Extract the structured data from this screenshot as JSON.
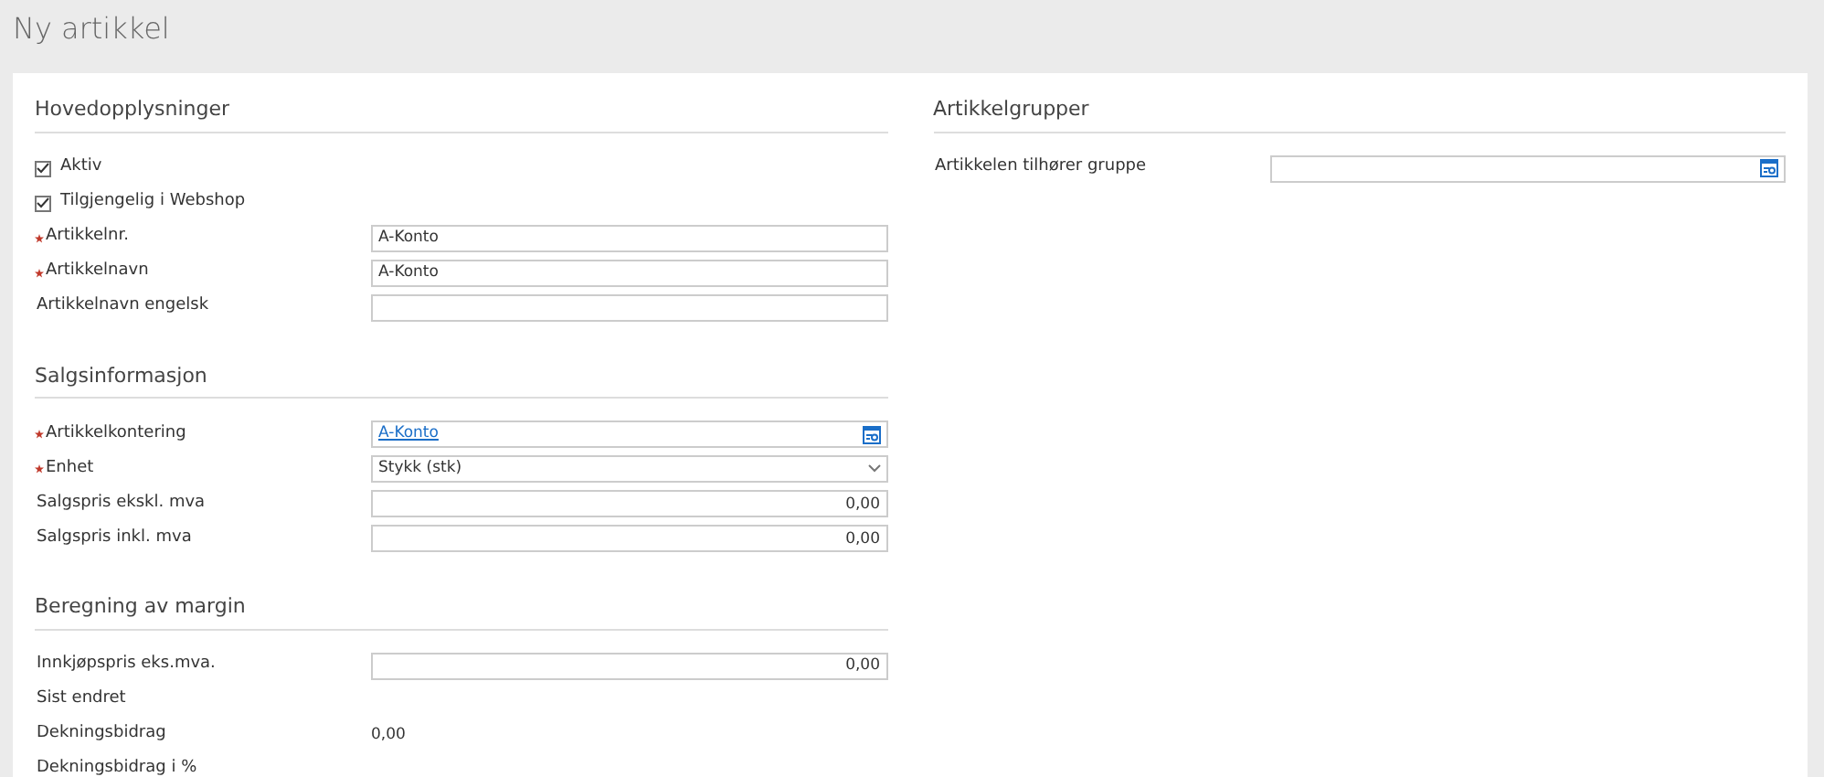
{
  "page_title": "Ny artikkel",
  "columns": [
    {
      "sections": [
        {
          "title": "Hovedopplysninger",
          "rows": [
            {
              "kind": "checkbox",
              "label": "Aktiv",
              "checked": true
            },
            {
              "kind": "checkbox",
              "label": "Tilgjengelig i Webshop",
              "checked": true
            },
            {
              "kind": "text",
              "label": "Artikkelnr.",
              "required": true,
              "value": "A-Konto"
            },
            {
              "kind": "text",
              "label": "Artikkelnavn",
              "required": true,
              "value": "A-Konto"
            },
            {
              "kind": "text",
              "label": "Artikkelnavn engelsk",
              "required": false
            }
          ]
        },
        {
          "title": "Salgsinformasjon",
          "rows": [
            {
              "kind": "lookup",
              "label": "Artikkelkontering",
              "required": true,
              "value": "A-Konto"
            },
            {
              "kind": "select",
              "label": "Enhet",
              "required": true,
              "value": "Stykk (stk)"
            },
            {
              "kind": "number",
              "label": "Salgspris ekskl. mva",
              "required": false,
              "value": "0,00"
            },
            {
              "kind": "number",
              "label": "Salgspris inkl. mva",
              "required": false,
              "value": "0,00"
            }
          ]
        },
        {
          "title": "Beregning av margin",
          "rows": [
            {
              "kind": "number",
              "label": "Innkjøpspris eks.mva.",
              "required": false,
              "value": "0,00"
            },
            {
              "kind": "static",
              "label": "Sist endret"
            },
            {
              "kind": "static",
              "label": "Dekningsbidrag",
              "value": "0,00"
            },
            {
              "kind": "static",
              "label": "Dekningsbidrag i %"
            }
          ]
        }
      ]
    },
    {
      "sections": [
        {
          "title": "Artikkelgrupper",
          "rows": [
            {
              "kind": "lookup",
              "label": "Artikkelen tilhører gruppe",
              "required": false
            }
          ]
        }
      ]
    }
  ]
}
